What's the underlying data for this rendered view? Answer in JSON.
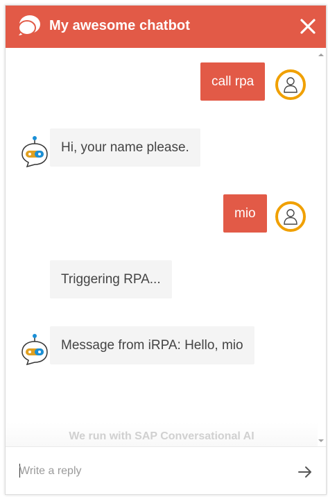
{
  "colors": {
    "brand": "#e25a47",
    "bot_bubble": "#f4f4f4",
    "avatar_ring": "#f0a000"
  },
  "header": {
    "title": "My awesome chatbot",
    "logo_icon": "chat-bubble-icon",
    "close_icon": "close-icon"
  },
  "conversation": [
    {
      "sender": "user",
      "text": "call rpa"
    },
    {
      "sender": "bot",
      "text": "Hi, your name please."
    },
    {
      "sender": "user",
      "text": "mio"
    },
    {
      "sender": "bot",
      "text": "Triggering RPA..."
    },
    {
      "sender": "bot",
      "text": "Message from iRPA: Hello, mio"
    }
  ],
  "branding": {
    "text": "We run with SAP Conversational AI"
  },
  "composer": {
    "placeholder": "Write a reply",
    "value": "",
    "send_icon": "arrow-right-icon"
  }
}
